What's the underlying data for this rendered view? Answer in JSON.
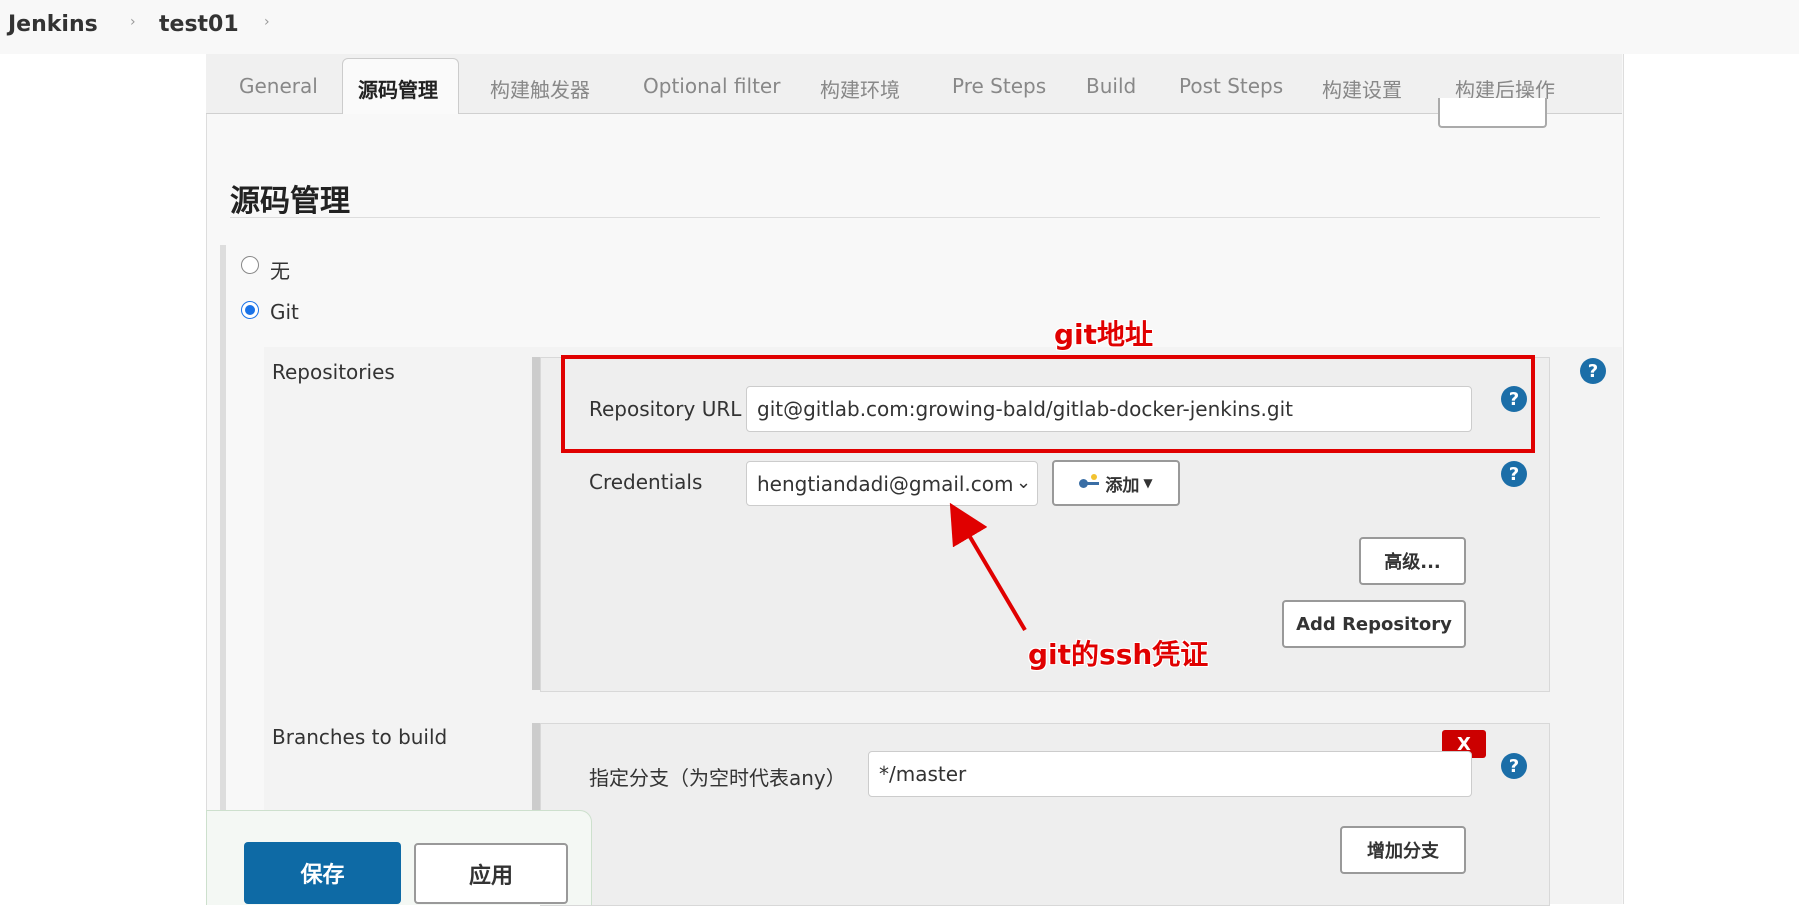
{
  "breadcrumb": {
    "items": [
      "Jenkins",
      "test01"
    ]
  },
  "tabs": [
    "General",
    "源码管理",
    "构建触发器",
    "Optional filter",
    "构建环境",
    "Pre Steps",
    "Build",
    "Post Steps",
    "构建设置",
    "构建后操作"
  ],
  "active_tab": "源码管理",
  "section": {
    "title": "源码管理"
  },
  "scm": {
    "options": [
      "无",
      "Git"
    ],
    "selected": "Git",
    "repositories_label": "Repositories",
    "repository_url_label": "Repository URL",
    "repository_url_value": "git@gitlab.com:growing-bald/gitlab-docker-jenkins.git",
    "credentials_label": "Credentials",
    "credentials_value": "hengtiandadi@gmail.com",
    "add_label": "添加",
    "advanced_label": "高级...",
    "add_repository_label": "Add Repository",
    "branches_label": "Branches to build",
    "branch_specifier_label": "指定分支（为空时代表any）",
    "branch_value": "*/master",
    "remove_label": "X",
    "add_branch_label": "增加分支"
  },
  "annotations": {
    "url_note": "git地址",
    "cred_note": "git的ssh凭证",
    "color": "#e00000"
  },
  "footer": {
    "save_label": "保存",
    "apply_label": "应用"
  },
  "colors": {
    "accent": "#0e6aa5",
    "help": "#1b6ea8",
    "danger": "#cc0000"
  },
  "help_symbol": "?"
}
